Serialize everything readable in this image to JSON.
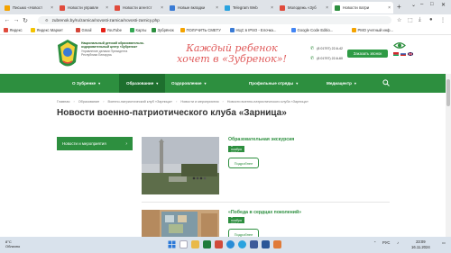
{
  "browser": {
    "tabs": [
      {
        "label": "Письмо «Новост",
        "color": "#f4a300",
        "active": false
      },
      {
        "label": "Новости управле",
        "color": "#e04b3c",
        "active": false
      },
      {
        "label": "Новости агентст",
        "color": "#e04b3c",
        "active": false
      },
      {
        "label": "Новые вкладки",
        "color": "#3a7bd5",
        "active": false
      },
      {
        "label": "Telegram Web",
        "color": "#2aa3df",
        "active": false
      },
      {
        "label": "Молодежь «Зуб",
        "color": "#e04b3c",
        "active": false
      },
      {
        "label": "Новости патри",
        "color": "#2d8f3f",
        "active": true
      }
    ],
    "new_tab": "+",
    "window_controls": [
      "⌄",
      "–",
      "□",
      "✕"
    ],
    "url": "zubrenok.by/ru/zarnica/novosti-zarnica/novosti-zarnicy.php",
    "bookmarks": [
      {
        "label": "Яндекс",
        "color": "#e04b3c"
      },
      {
        "label": "Яндекс Маркет",
        "color": "#f4c300"
      },
      {
        "label": "Gmail",
        "color": "#d44638"
      },
      {
        "label": "YouTube",
        "color": "#e62117"
      },
      {
        "label": "Карты",
        "color": "#34a853"
      },
      {
        "label": "Зубрёнок",
        "color": "#2d8f3f"
      },
      {
        "label": "ПОЛУЧИТЬ СМЕТУ",
        "color": "#f4a300"
      },
      {
        "label": "НЦС в IPSO - Елочка...",
        "color": "#3a7bd5"
      },
      {
        "label": "Google Code Editio...",
        "color": "#4285f4"
      },
      {
        "label": "PMO учетный инф...",
        "color": "#f4a300"
      }
    ]
  },
  "site": {
    "org_name": "Национальный детский образовательно-оздоровительный центр «Зубренок»",
    "org_sub": "Управление делами Президента Республики Беларусь",
    "banner_line1": "Каждый ребенок",
    "banner_line2": "хочет в «Зубренок»!",
    "phone1": "(8 01797) 22-6-42",
    "phone2": "(8 01797) 22-6-60",
    "call_button": "Заказать звонок",
    "menu": [
      {
        "label": "О Зубренке",
        "active": false
      },
      {
        "label": "Образование",
        "active": true
      },
      {
        "label": "Оздоровление",
        "active": false
      },
      {
        "label": "Профильные отряды",
        "active": false
      },
      {
        "label": "Медиацентр",
        "active": false
      }
    ],
    "breadcrumb": [
      "Главная",
      "Образование",
      "Военно-патриотический клуб «Зарница»",
      "Новости и мероприятия",
      "Новости военно-патриотического клуба «Зарница»"
    ],
    "title": "Новости военно-патриотического клуба «Зарница»",
    "sidebar_item": "Новости и мероприятия",
    "news": [
      {
        "title": "Образовательная экскурсия",
        "date": "8 ноября 2024",
        "button": "Подробнее"
      },
      {
        "title": "«Победа в сердцах поколений»",
        "date": "8 ноября 2024",
        "button": "Подробнее"
      }
    ]
  },
  "taskbar": {
    "weather_temp": "8°C",
    "weather_text": "Облачно",
    "lang": "РУС",
    "time": "23:09",
    "date": "16.11.2024"
  }
}
